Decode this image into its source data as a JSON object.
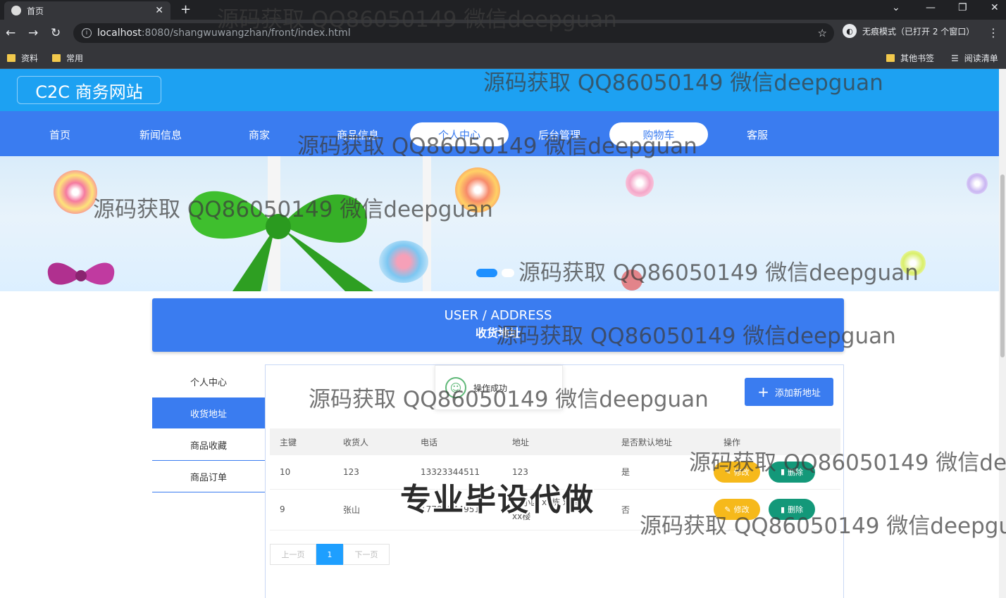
{
  "browser": {
    "tab_title": "首页",
    "tab_close": "✕",
    "new_tab": "+",
    "url_host": "localhost",
    "url_path": ":8080/shangwuwangzhan/front/index.html",
    "incognito_label": "无痕模式（已打开 2 个窗口）",
    "bookmarks": [
      "资料",
      "常用"
    ],
    "other_bookmarks": "其他书签",
    "reading_list": "阅读清单"
  },
  "site": {
    "logo": "C2C 商务网站",
    "nav": [
      "首页",
      "新闻信息",
      "商家",
      "商品信息",
      "个人中心",
      "后台管理",
      "购物车",
      "客服"
    ]
  },
  "section": {
    "title_en": "USER / ADDRESS",
    "title_cn": "收货地址"
  },
  "sidebar": {
    "items": [
      "个人中心",
      "收货地址",
      "商品收藏",
      "商品订单"
    ]
  },
  "toast": "操作成功",
  "add_button": "添加新地址",
  "table": {
    "headers": [
      "主键",
      "收货人",
      "电话",
      "地址",
      "是否默认地址",
      "操作"
    ],
    "rows": [
      {
        "id": "10",
        "name": "123",
        "phone": "13323344511",
        "address": "123",
        "default": "是"
      },
      {
        "id": "9",
        "name": "张山",
        "phone": "17785544951",
        "address": "xx小区 xx栋 xx单元 xx楼",
        "default": "否"
      }
    ],
    "edit_label": "修改",
    "delete_label": "删除"
  },
  "pager": {
    "prev": "上一页",
    "current": "1",
    "next": "下一页"
  },
  "overlay": {
    "watermark": "源码获取 QQ86050149 微信deepguan",
    "caption": "专业毕设代做"
  },
  "colors": {
    "header": "#1da1f2",
    "nav": "#3a7cf0",
    "edit": "#f6b91b",
    "delete": "#139879"
  }
}
